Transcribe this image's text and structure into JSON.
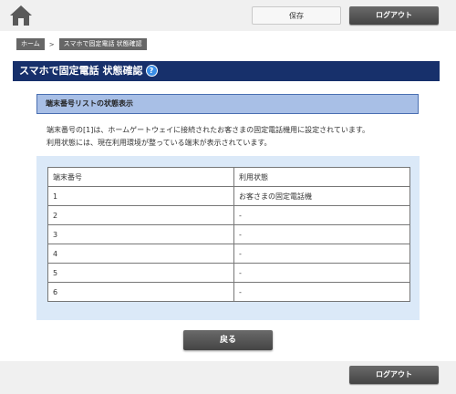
{
  "header": {
    "home_icon": "home-icon",
    "save_label": "保存",
    "logout_label": "ログアウト"
  },
  "breadcrumb": {
    "home": "ホーム",
    "separator": ">",
    "current": "スマホで固定電話 状態確認"
  },
  "page": {
    "title": "スマホで固定電話 状態確認",
    "help_icon": "?"
  },
  "section": {
    "title": "端末番号リストの状態表示",
    "desc_line1": "端末番号の[1]は、ホームゲートウェイに接続されたお客さまの固定電話機用に設定されています。",
    "desc_line2": "利用状態には、現在利用環境が整っている端末が表示されています。"
  },
  "table": {
    "headers": [
      "端末番号",
      "利用状態"
    ],
    "rows": [
      [
        "1",
        "お客さまの固定電話機"
      ],
      [
        "2",
        "-"
      ],
      [
        "3",
        "-"
      ],
      [
        "4",
        "-"
      ],
      [
        "5",
        "-"
      ],
      [
        "6",
        "-"
      ]
    ]
  },
  "buttons": {
    "back_label": "戻る"
  },
  "footer": {
    "logout_label": "ログアウト"
  },
  "colors": {
    "title_bar": "#17306b",
    "section_head": "#a8bfe6",
    "table_bg": "#dbe9f8",
    "help_icon": "#3a8ee6"
  }
}
